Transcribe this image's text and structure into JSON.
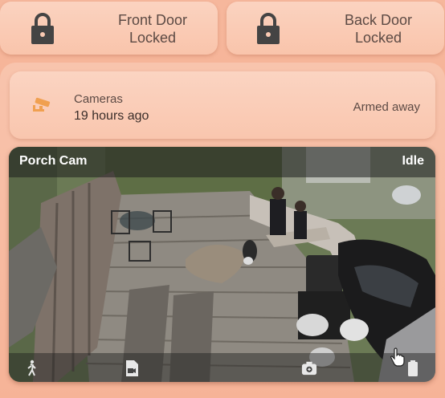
{
  "locks": [
    {
      "name": "Front Door",
      "state": "Locked",
      "icon": "lock-icon"
    },
    {
      "name": "Back Door",
      "state": "Locked",
      "icon": "lock-icon"
    }
  ],
  "alarm": {
    "name": "Cameras",
    "last_changed": "19 hours ago",
    "state": "Armed away",
    "icon": "cctv-icon",
    "icon_color": "#f0a050"
  },
  "camera": {
    "title": "Porch Cam",
    "status": "Idle",
    "actions": [
      "motion-icon",
      "video-file-icon",
      "snapshot-icon",
      "battery-icon"
    ]
  },
  "colors": {
    "background": "#f6b79c",
    "card": "#fbd3c0",
    "icon_dark": "#4a4a4a",
    "text": "#5c4a44"
  }
}
